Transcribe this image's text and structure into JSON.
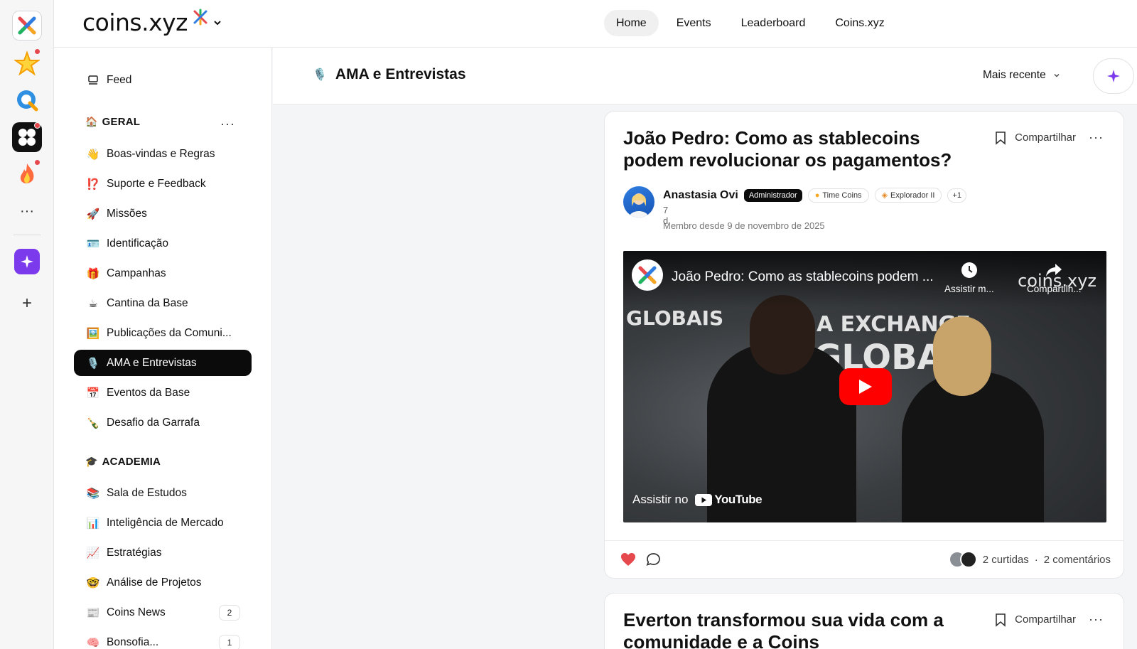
{
  "brand": {
    "name": "coins.xyz"
  },
  "nav": [
    {
      "label": "Home",
      "active": true
    },
    {
      "label": "Events",
      "active": false
    },
    {
      "label": "Leaderboard",
      "active": false
    },
    {
      "label": "Coins.xyz",
      "active": false
    }
  ],
  "sidebar": {
    "feed": {
      "icon": "feed-icon",
      "label": "Feed"
    },
    "sections": [
      {
        "title": "GERAL",
        "emoji": "🏠",
        "items": [
          {
            "emoji": "👋",
            "label": "Boas-vindas e Regras"
          },
          {
            "emoji": "⁉️",
            "label": "Suporte e Feedback"
          },
          {
            "emoji": "🚀",
            "label": "Missões"
          },
          {
            "emoji": "🪪",
            "label": "Identificação"
          },
          {
            "emoji": "🎁",
            "label": "Campanhas"
          },
          {
            "emoji": "☕",
            "label": "Cantina da Base"
          },
          {
            "emoji": "🖼️",
            "label": "Publicações da Comuni..."
          },
          {
            "emoji": "🎙️",
            "label": "AMA e Entrevistas",
            "active": true
          },
          {
            "emoji": "📅",
            "label": "Eventos da Base"
          },
          {
            "emoji": "🍾",
            "label": "Desafio da Garrafa"
          }
        ]
      },
      {
        "title": "ACADEMIA",
        "emoji": "🎓",
        "items": [
          {
            "emoji": "📚",
            "label": "Sala de Estudos"
          },
          {
            "emoji": "📊",
            "label": "Inteligência de Mercado"
          },
          {
            "emoji": "📈",
            "label": "Estratégias"
          },
          {
            "emoji": "🤓",
            "label": "Análise de Projetos"
          },
          {
            "emoji": "📰",
            "label": "Coins News",
            "badge": "2"
          },
          {
            "emoji": "🧠",
            "label": "Bonsofia...",
            "badge": "1"
          }
        ]
      }
    ]
  },
  "main": {
    "title": "AMA e Entrevistas",
    "title_icon": "microphone-icon",
    "sort_label": "Mais recente"
  },
  "posts": [
    {
      "title": "João Pedro: Como as stablecoins podem revolucionar os pagamentos?",
      "share_label": "Compartilhar",
      "author": {
        "name": "Anastasia Ovi",
        "role": "Administrador",
        "tags": [
          "Time Coins",
          "Explorador II"
        ],
        "extra": "+1",
        "time": "7 d",
        "since": "Membro desde 9 de novembro de 2025"
      },
      "video": {
        "title": "João Pedro: Como as stablecoins podem ...",
        "watch_later": "Assistir m...",
        "share": "Compartilh...",
        "watermark": "coins.xyz",
        "watch_on": "Assistir no",
        "platform": "YouTube",
        "bg_text_1": "GLOBAIS",
        "bg_text_2": "A EXCHANGE",
        "bg_text_3": "GLOBAL"
      },
      "likes": "2 curtidas",
      "comments": "2 comentários",
      "separator": "·"
    },
    {
      "title": "Everton transformou sua vida com a comunidade e a Coins",
      "share_label": "Compartilhar"
    }
  ],
  "colors": {
    "accent": "#7c3aed",
    "like": "#e5484d",
    "active_bg": "#0b0b0c"
  }
}
